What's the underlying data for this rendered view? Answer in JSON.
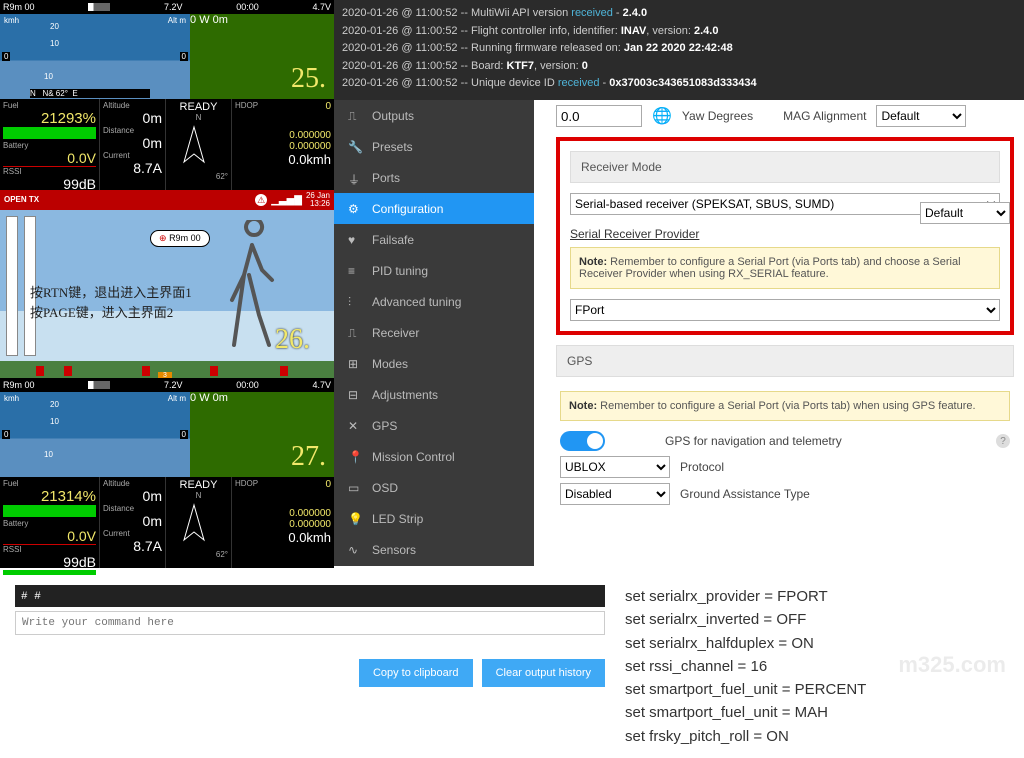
{
  "titlebar": {
    "model": "R9m 00",
    "v1": "7.2V",
    "t": "00:00",
    "v2": "4.7V"
  },
  "hud": {
    "kmh": "kmh",
    "altm": "Alt m",
    "sky_ticks": [
      "20",
      "10",
      "10"
    ],
    "zeroL": "0",
    "zeroR": "0",
    "compass": {
      "dir": "N",
      "deg": "N& 62°",
      "w": "W",
      "e": "E",
      "dist": "0m"
    },
    "number25": "25.",
    "number26": "26.",
    "number27": "27."
  },
  "telem1": {
    "fuel_lbl": "Fuel",
    "fuel": "21293%",
    "batt_lbl": "Battery",
    "batt": "0.0V",
    "rssi_lbl": "RSSI",
    "rssi": "99dB",
    "alt_lbl": "Altitude",
    "alt": "0m",
    "dist_lbl": "Distance",
    "dist": "0m",
    "cur_lbl": "Current",
    "cur": "8.7A",
    "ready": "READY",
    "n": "N",
    "hdop": "HDOP",
    "hdop_v": "0",
    "deg": "62°",
    "lat": "0.000000",
    "lon": "0.000000",
    "spd": "0.0kmh"
  },
  "telem2": {
    "fuel_lbl": "Fuel",
    "fuel": "21314%",
    "batt_lbl": "Battery",
    "batt": "0.0V",
    "rssi_lbl": "RSSI",
    "rssi": "99dB",
    "alt_lbl": "Altitude",
    "alt": "0m",
    "dist_lbl": "Distance",
    "dist": "0m",
    "cur_lbl": "Current",
    "cur": "8.7A",
    "ready": "READY",
    "n": "N",
    "hdop": "HDOP",
    "hdop_v": "0",
    "deg": "62°",
    "lat": "0.000000",
    "lon": "0.000000",
    "spd": "0.0kmh"
  },
  "opentx": {
    "brand": "OPEN TX",
    "date": "26 Jan",
    "time": "13:26",
    "bubble": "R9m 00",
    "line1": "按RTN键，退出进入主界面1",
    "line2": "按PAGE键，进入主界面2"
  },
  "log": [
    {
      "ts": "2020-01-26 @ 11:00:52",
      "txt": "MultiWii API version",
      "hl": "received",
      "rest": " - ",
      "bold": "2.4.0"
    },
    {
      "ts": "2020-01-26 @ 11:00:52",
      "txt": "Flight controller info, identifier:",
      "bold": "INAV",
      "rest2": ", version:",
      "bold2": "2.4.0"
    },
    {
      "ts": "2020-01-26 @ 11:00:52",
      "txt": "Running firmware released on:",
      "bold": "Jan 22 2020 22:42:48"
    },
    {
      "ts": "2020-01-26 @ 11:00:52",
      "txt": "Board:",
      "bold": "KTF7",
      "rest2": ", version:",
      "bold2": "0"
    },
    {
      "ts": "2020-01-26 @ 11:00:52",
      "txt": "Unique device ID",
      "hl": "received",
      "rest": " - ",
      "bold": "0x37003c343651083d333434"
    }
  ],
  "sidebar": {
    "items": [
      {
        "label": "Outputs",
        "icon": "outputs"
      },
      {
        "label": "Presets",
        "icon": "presets"
      },
      {
        "label": "Ports",
        "icon": "ports"
      },
      {
        "label": "Configuration",
        "icon": "config",
        "active": true
      },
      {
        "label": "Failsafe",
        "icon": "failsafe"
      },
      {
        "label": "PID tuning",
        "icon": "pid"
      },
      {
        "label": "Advanced tuning",
        "icon": "adv"
      },
      {
        "label": "Receiver",
        "icon": "rx"
      },
      {
        "label": "Modes",
        "icon": "modes"
      },
      {
        "label": "Adjustments",
        "icon": "adj"
      },
      {
        "label": "GPS",
        "icon": "gps"
      },
      {
        "label": "Mission Control",
        "icon": "mission"
      },
      {
        "label": "OSD",
        "icon": "osd"
      },
      {
        "label": "LED Strip",
        "icon": "led"
      },
      {
        "label": "Sensors",
        "icon": "sensors"
      }
    ]
  },
  "config": {
    "yaw_value": "0.0",
    "yaw_label": "Yaw Degrees",
    "mag_label": "MAG Alignment",
    "mag_value": "Default",
    "rx_header": "Receiver Mode",
    "rx_value": "Serial-based receiver (SPEKSAT, SBUS, SUMD)",
    "srp_header": "Serial Receiver Provider",
    "note1_b": "Note:",
    "note1": "Remember to configure a Serial Port (via Ports tab) and choose a Serial Receiver Provider when using RX_SERIAL feature.",
    "srp_value": "FPort",
    "gps_header": "GPS",
    "note2_b": "Note:",
    "note2": "Remember to configure a Serial Port (via Ports tab) when using GPS feature.",
    "gps_toggle_label": "GPS for navigation and telemetry",
    "proto_value": "UBLOX",
    "proto_label": "Protocol",
    "gat_value": "Disabled",
    "gat_label": "Ground Assistance Type"
  },
  "cli": {
    "prompt": "# #",
    "placeholder": "Write your command here",
    "copy": "Copy to clipboard",
    "clear": "Clear output history"
  },
  "commands": [
    "set serialrx_provider = FPORT",
    "set serialrx_inverted = OFF",
    "set serialrx_halfduplex = ON",
    "set rssi_channel = 16",
    "set smartport_fuel_unit = PERCENT",
    "set smartport_fuel_unit = MAH",
    "set frsky_pitch_roll = ON"
  ],
  "watermark": "m325.com"
}
